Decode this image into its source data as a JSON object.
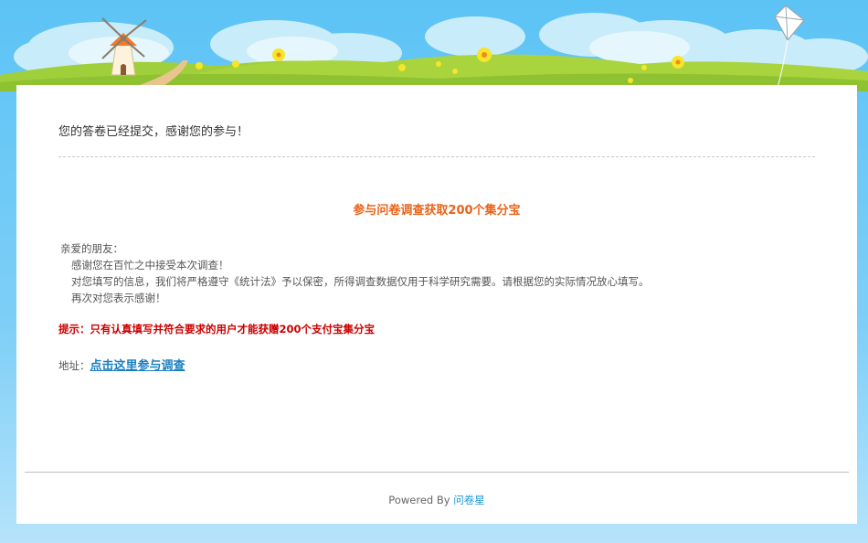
{
  "thanks_message": "您的答卷已经提交，感谢您的参与！",
  "promo": {
    "title": "参与问卷调查获取200个集分宝"
  },
  "letter": {
    "greeting": "亲爱的朋友：",
    "line1": "感谢您在百忙之中接受本次调查！",
    "line2": "对您填写的信息，我们将严格遵守《统计法》予以保密，所得调查数据仅用于科学研究需要。请根据您的实际情况放心填写。",
    "line3": "再次对您表示感谢！"
  },
  "tip": "提示：只有认真填写并符合要求的用户才能获赠200个支付宝集分宝",
  "address": {
    "label": "地址：",
    "link_text": "点击这里参与调查"
  },
  "footer": {
    "powered_by": "Powered By",
    "brand": "问卷星"
  },
  "colors": {
    "sky": "#5cc3f5",
    "promo": "#e8631a",
    "tip": "#cc0000",
    "link": "#1a7fc0"
  }
}
